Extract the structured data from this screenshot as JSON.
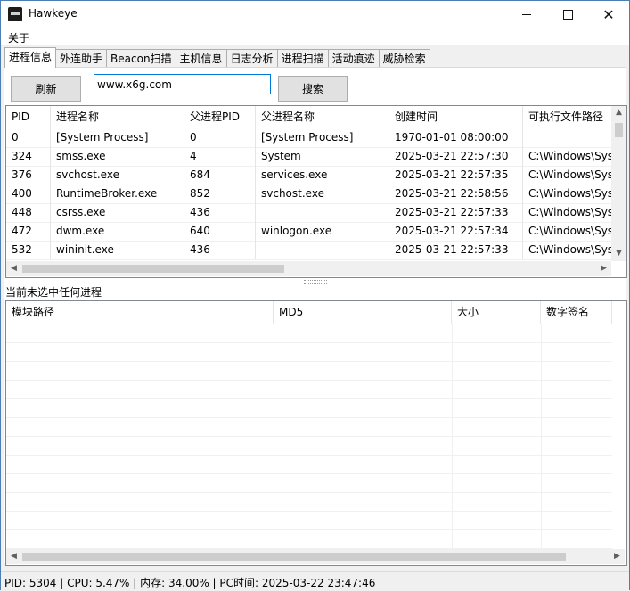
{
  "window": {
    "title": "Hawkeye"
  },
  "menu": {
    "about": "关于"
  },
  "tabs": [
    "进程信息",
    "外连助手",
    "Beacon扫描",
    "主机信息",
    "日志分析",
    "进程扫描",
    "活动痕迹",
    "威胁检索"
  ],
  "toolbar": {
    "refresh_label": "刷新",
    "search_value": "www.x6g.com",
    "search_label": "搜索"
  },
  "process_table": {
    "columns": [
      "PID",
      "进程名称",
      "父进程PID",
      "父进程名称",
      "创建时间",
      "可执行文件路径"
    ],
    "rows": [
      [
        "0",
        "[System Process]",
        "0",
        "[System Process]",
        "1970-01-01 08:00:00",
        ""
      ],
      [
        "324",
        "smss.exe",
        "4",
        "System",
        "2025-03-21 22:57:30",
        "C:\\Windows\\Sys"
      ],
      [
        "376",
        "svchost.exe",
        "684",
        "services.exe",
        "2025-03-21 22:57:35",
        "C:\\Windows\\Sys"
      ],
      [
        "400",
        "RuntimeBroker.exe",
        "852",
        "svchost.exe",
        "2025-03-21 22:58:56",
        "C:\\Windows\\Sys"
      ],
      [
        "448",
        "csrss.exe",
        "436",
        "",
        "2025-03-21 22:57:33",
        "C:\\Windows\\Sys"
      ],
      [
        "472",
        "dwm.exe",
        "640",
        "winlogon.exe",
        "2025-03-21 22:57:34",
        "C:\\Windows\\Sys"
      ],
      [
        "532",
        "wininit.exe",
        "436",
        "",
        "2025-03-21 22:57:33",
        "C:\\Windows\\Sys"
      ]
    ]
  },
  "selection_status": "当前未选中任何进程",
  "module_table": {
    "columns": [
      "模块路径",
      "MD5",
      "大小",
      "数字签名"
    ]
  },
  "statusbar": {
    "text": "PID: 5304 | CPU: 5.47% | 内存: 34.00% | PC时间: 2025-03-22 23:47:46"
  }
}
